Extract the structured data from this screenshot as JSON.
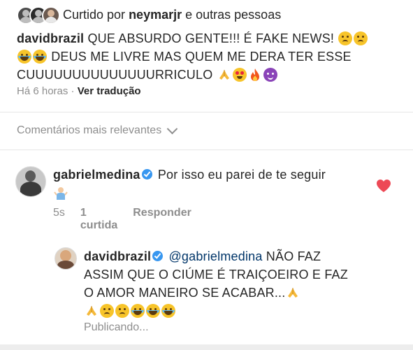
{
  "likes": {
    "prefix": "Curtido por",
    "user": "neymarjr",
    "suffix": "e outras pessoas"
  },
  "caption": {
    "username": "davidbrazil",
    "text_1": "QUE ABSURDO GENTE!!! É FAKE NEWS!",
    "text_2": "DEUS ME LIVRE MAS QUEM ME DERA TER ESSE CUUUUUUUUUUUUUURRICULO"
  },
  "caption_meta": {
    "time": "Há 6 horas",
    "separator": "·",
    "translate": "Ver tradução"
  },
  "comments_header": {
    "label": "Comentários mais relevantes"
  },
  "comments": [
    {
      "username": "gabrielmedina",
      "text": "Por isso eu parei de te seguir",
      "time": "5s",
      "likes": "1 curtida",
      "reply": "Responder",
      "liked": true
    }
  ],
  "reply": {
    "username": "davidbrazil",
    "mention": "@gabrielmedina",
    "text": "NÃO FAZ ASSIM QUE O CIÚME É TRAIÇOEIRO E FAZ O AMOR MANEIRO SE ACABAR...",
    "status": "Publicando..."
  },
  "colors": {
    "text": "#262626",
    "muted": "#8e8e8e",
    "mention": "#003569",
    "verified": "#3897f0",
    "like_heart": "#ed4956"
  },
  "icons": {
    "verified": "verified-badge-icon",
    "heart": "heart-icon",
    "chevron": "chevron-down-icon"
  }
}
